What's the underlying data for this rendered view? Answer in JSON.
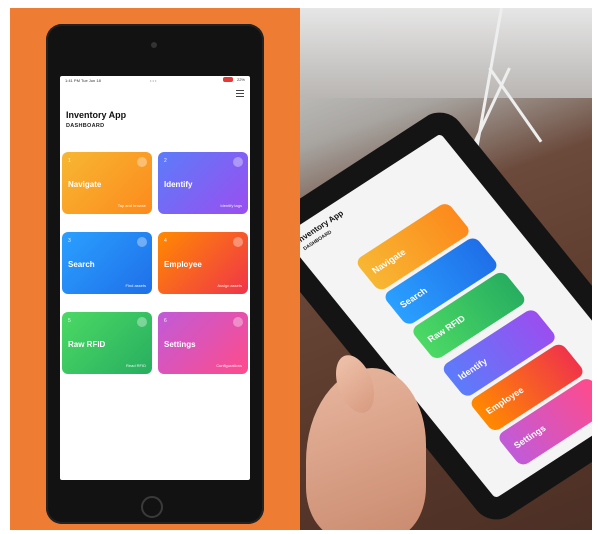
{
  "left_panel": {
    "status": {
      "time": "1:41 PM",
      "date": "Tue Jun 18",
      "dots": "• • •",
      "battery": "22%"
    },
    "header": {
      "title": "Inventory App",
      "subtitle": "DASHBOARD"
    },
    "tiles": [
      {
        "num": "1",
        "name": "Navigate",
        "desc": "Tap and browse",
        "color": "#fc8a1c"
      },
      {
        "num": "2",
        "name": "Identify",
        "desc": "Identify tags",
        "color": "#7b5cf5"
      },
      {
        "num": "3",
        "name": "Search",
        "desc": "Find assets",
        "color": "#1f6fe8"
      },
      {
        "num": "4",
        "name": "Employee",
        "desc": "Assign assets",
        "color": "#f0344a"
      },
      {
        "num": "5",
        "name": "Raw RFID",
        "desc": "Read RFID",
        "color": "#27ae60"
      },
      {
        "num": "6",
        "name": "Settings",
        "desc": "Configurations",
        "color": "#e04bb0"
      }
    ]
  },
  "right_panel": {
    "header": {
      "title": "Inventory App",
      "subtitle": "DASHBOARD"
    },
    "tiles": [
      {
        "name": "Navigate"
      },
      {
        "name": "Search"
      },
      {
        "name": "Raw RFID"
      },
      {
        "name": "Identify"
      },
      {
        "name": "Employee"
      },
      {
        "name": "Settings"
      }
    ]
  },
  "colors": {
    "background_left": "#ee7d33",
    "tablet_bezel": "#121212"
  }
}
